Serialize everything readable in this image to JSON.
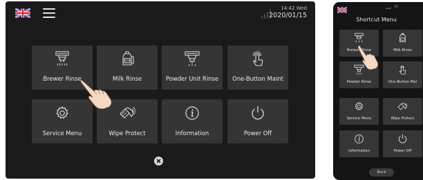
{
  "main_screen": {
    "time": "14:42 Wed",
    "date": "2020/01/15",
    "tiles": [
      {
        "label": "Brewer Rinse",
        "icon": "brewer-rinse-icon"
      },
      {
        "label": "Milk Rinse",
        "icon": "milk-rinse-icon"
      },
      {
        "label": "Powder Unit Rinse",
        "icon": "powder-unit-rinse-icon"
      },
      {
        "label": "One-Button Maint",
        "icon": "touch-finger-icon"
      },
      {
        "label": "Service Menu",
        "icon": "gear-icon"
      },
      {
        "label": "Wipe Protect",
        "icon": "wipe-protect-icon"
      },
      {
        "label": "Information",
        "icon": "info-icon"
      },
      {
        "label": "Power Off",
        "icon": "power-icon"
      }
    ]
  },
  "tablet": {
    "time": "20",
    "title": "Shortcut Menu",
    "tiles": [
      {
        "label": "Brewer Rinse"
      },
      {
        "label": "Milk Rinse"
      },
      {
        "label": "Powder Rinse"
      },
      {
        "label": "One-Button Mai"
      },
      {
        "label": "Service Menu"
      },
      {
        "label": "Wipe Protect"
      },
      {
        "label": "Information"
      },
      {
        "label": "Power Off"
      }
    ],
    "back_label": "Back"
  },
  "colors": {
    "screen_bg": "#1a1a1a",
    "tile_bg": "#353535",
    "text": "#eaeaea",
    "flag_blue": "#1f3a93",
    "flag_red": "#d21f2d"
  }
}
